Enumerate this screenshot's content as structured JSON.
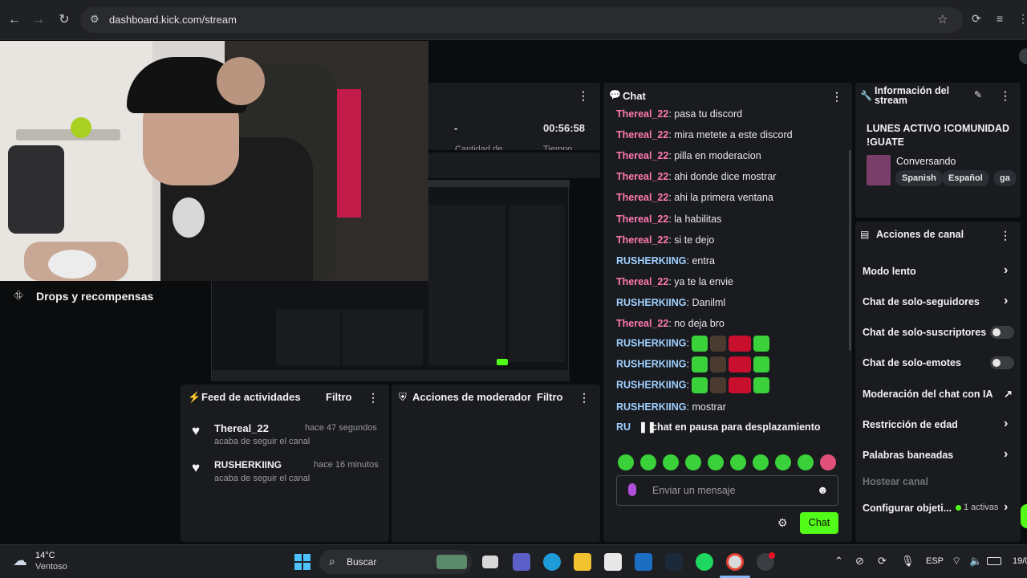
{
  "browser": {
    "url": "dashboard.kick.com/stream"
  },
  "stats": {
    "dash": "-",
    "time": "00:56:58",
    "label_a": "Cantidad de",
    "label_b": "Tiempo"
  },
  "drops": {
    "title": "Drops y recompensas"
  },
  "activity_feed": {
    "title": "Feed de actividades",
    "filter_label": "Filtro",
    "items": [
      {
        "user": "Thereal_22",
        "time": "hace 47 segundos",
        "desc": "acaba de seguir el canal"
      },
      {
        "user": "RUSHERKIING",
        "time": "hace 16 minutos",
        "desc": "acaba de seguir el canal"
      }
    ]
  },
  "mod_actions": {
    "title": "Acciones de moderador",
    "filter_label": "Filtro"
  },
  "chat": {
    "title": "Chat",
    "messages": [
      {
        "user": "Thereal_22",
        "text": "pasa tu discord"
      },
      {
        "user": "Thereal_22",
        "text": "mira metete a este discord"
      },
      {
        "user": "Thereal_22",
        "text": "pilla en moderacion"
      },
      {
        "user": "Thereal_22",
        "text": "ahi donde dice mostrar"
      },
      {
        "user": "Thereal_22",
        "text": "ahi la primera ventana"
      },
      {
        "user": "Thereal_22",
        "text": "la habilitas"
      },
      {
        "user": "Thereal_22",
        "text": "si te dejo"
      },
      {
        "user": "RUSHERKIING",
        "text": "entra"
      },
      {
        "user": "Thereal_22",
        "text": "ya te la envie"
      },
      {
        "user": "RUSHERKIING",
        "text": "Danilml"
      },
      {
        "user": "Thereal_22",
        "text": "no deja bro"
      },
      {
        "user": "RUSHERKIING",
        "text": ""
      },
      {
        "user": "RUSHERKIING",
        "text": ""
      },
      {
        "user": "RUSHERKIING",
        "text": ""
      },
      {
        "user": "RUSHERKIING",
        "text": "mostrar"
      }
    ],
    "paused_prefix": "RU",
    "paused_text": "chat en pausa para desplazamiento",
    "input_placeholder": "Enviar un mensaje",
    "send_label": "Chat"
  },
  "stream_info": {
    "title": "Información del stream",
    "stream_title": "LUNES ACTIVO !COMUNIDAD !GUATE",
    "category": "Conversando",
    "tags": [
      "Spanish",
      "Español",
      "ga"
    ]
  },
  "channel_actions": {
    "title": "Acciones de canal",
    "items": [
      {
        "label": "Modo lento",
        "control": "chevron"
      },
      {
        "label": "Chat de solo-seguidores",
        "control": "chevron"
      },
      {
        "label": "Chat de solo-suscriptores",
        "control": "toggle"
      },
      {
        "label": "Chat de solo-emotes",
        "control": "toggle"
      },
      {
        "label": "Moderación del chat con IA",
        "control": "external"
      },
      {
        "label": "Restricción de edad",
        "control": "chevron"
      },
      {
        "label": "Palabras baneadas",
        "control": "chevron"
      }
    ],
    "host_label": "Hostear canal",
    "goals_label": "Configurar objeti...",
    "goals_badge": "1 activas"
  },
  "taskbar": {
    "weather_temp": "14°C",
    "weather_desc": "Ventoso",
    "search_label": "Buscar",
    "lang": "ESP",
    "date": "19/0"
  },
  "colors": {
    "accent": "#53fc18",
    "panel": "#191b1f",
    "pink": "#ff7ab0",
    "blue": "#9fd0ff"
  }
}
